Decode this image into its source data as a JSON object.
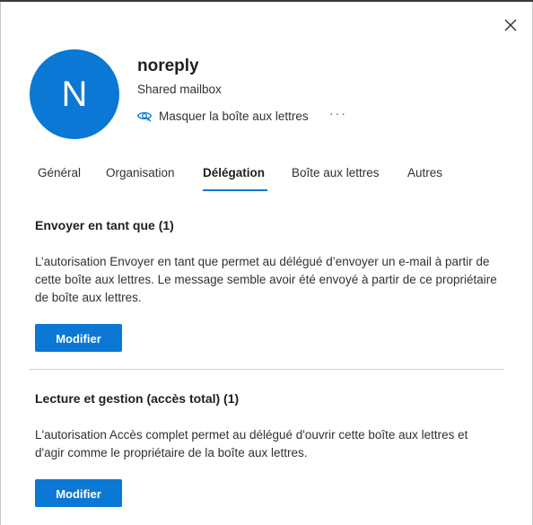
{
  "header": {
    "avatar_initial": "N",
    "name": "noreply",
    "subtitle": "Shared mailbox",
    "hide_action_label": "Masquer la boîte aux lettres",
    "more_label": "···",
    "close_icon": "close-icon",
    "eye_icon": "eye-hide-icon",
    "avatar_color": "#0a78d4"
  },
  "tabs": [
    {
      "label": "Général",
      "active": false
    },
    {
      "label": "Organisation",
      "active": false
    },
    {
      "label": "Délégation",
      "active": true
    },
    {
      "label": "Boîte aux lettres",
      "active": false
    },
    {
      "label": "Autres",
      "active": false
    }
  ],
  "sections": [
    {
      "title": "Envoyer en tant que (1)",
      "description": "L’autorisation Envoyer en tant que permet au délégué d’envoyer un e-mail à partir de cette boîte aux lettres. Le message semble avoir été envoyé à partir de ce propriétaire de boîte aux lettres.",
      "button_label": "Modifier"
    },
    {
      "title": "Lecture et gestion (accès total) (1)",
      "description": "L'autorisation Accès complet permet au délégué d'ouvrir cette boîte aux lettres et d'agir comme le propriétaire de la boîte aux lettres.",
      "button_label": "Modifier"
    }
  ],
  "colors": {
    "accent": "#0a78d4",
    "text": "#201f1e",
    "divider": "#d2d0ce"
  }
}
